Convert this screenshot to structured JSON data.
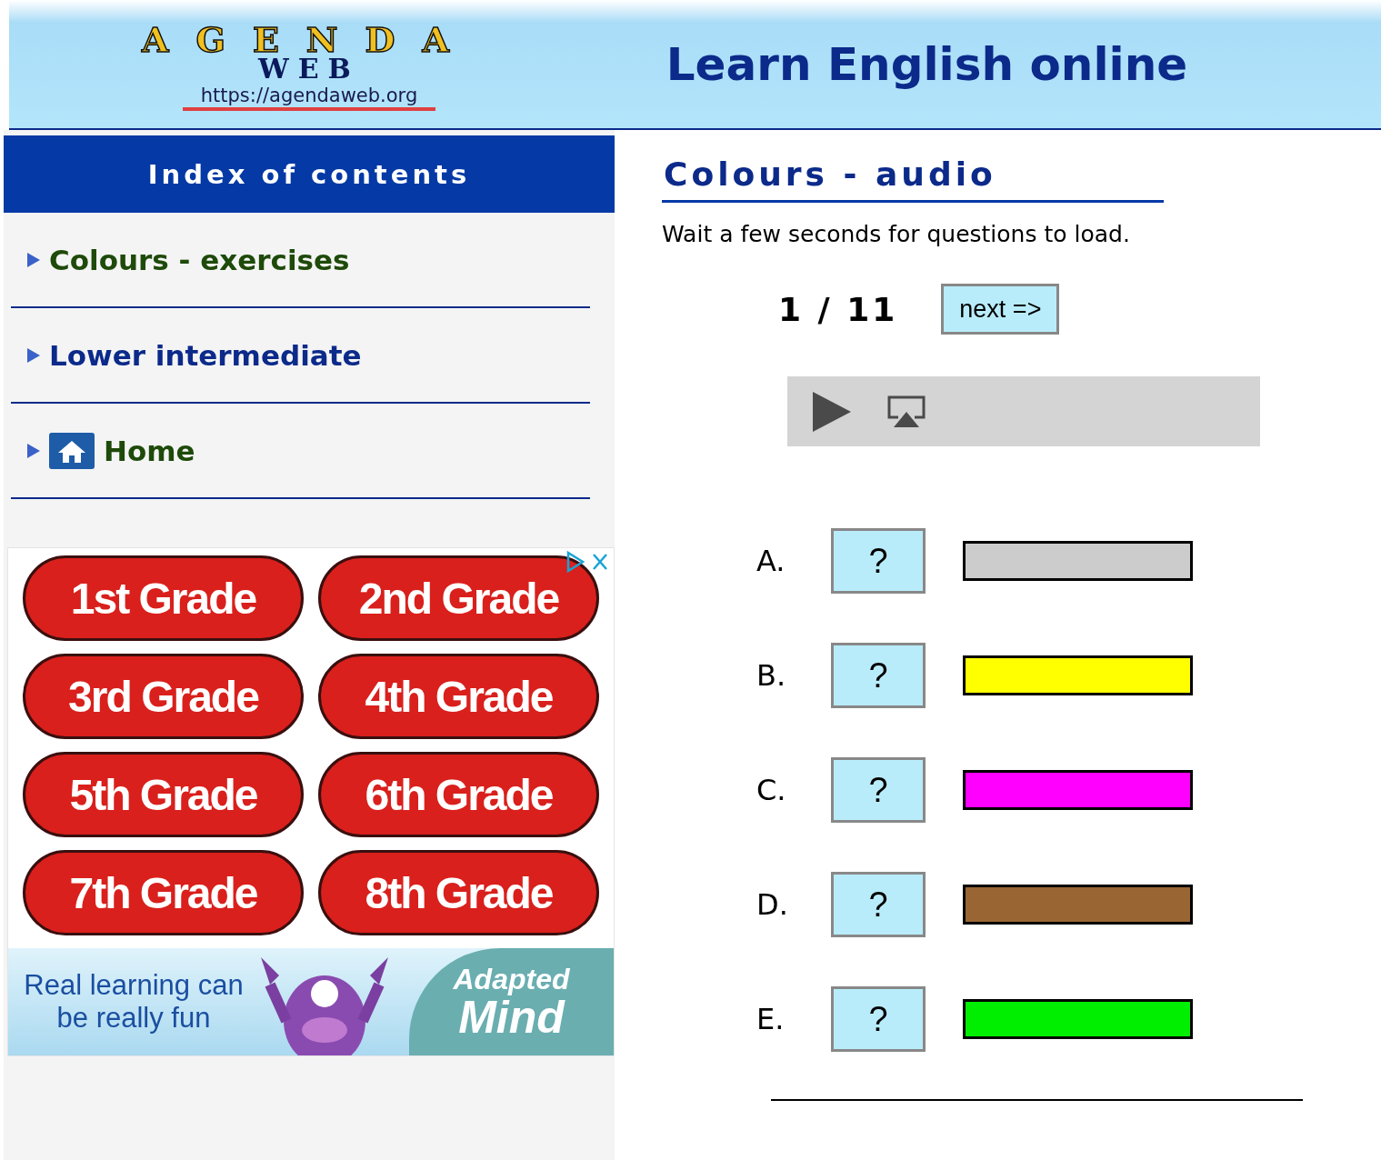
{
  "header": {
    "logo": {
      "word": "AGENDA",
      "sub": "WEB",
      "url": "https://agendaweb.org"
    },
    "title": "Learn English online"
  },
  "sidebar": {
    "title": "Index of contents",
    "items": [
      {
        "label": "Colours - exercises",
        "kind": "link",
        "color": "#1e4a0a"
      },
      {
        "label": "Lower intermediate",
        "kind": "link",
        "color": "#0b2a8a"
      },
      {
        "label": "Home",
        "kind": "home",
        "color": "#1e4a0a"
      }
    ]
  },
  "ad": {
    "grades": [
      "1st Grade",
      "2nd Grade",
      "3rd Grade",
      "4th Grade",
      "5th Grade",
      "6th Grade",
      "7th Grade",
      "8th Grade"
    ],
    "tagline": "Real learning can be really fun",
    "brand_top": "Adapted",
    "brand_bottom": "Mind"
  },
  "exercise": {
    "title": "Colours - audio",
    "instruction": "Wait a few seconds for questions to load.",
    "counter": "1 / 11",
    "next": "next =>",
    "options": [
      {
        "letter": "A.",
        "answer": "?",
        "color": "#cccccc"
      },
      {
        "letter": "B.",
        "answer": "?",
        "color": "#ffff00"
      },
      {
        "letter": "C.",
        "answer": "?",
        "color": "#ff00ff"
      },
      {
        "letter": "D.",
        "answer": "?",
        "color": "#996633"
      },
      {
        "letter": "E.",
        "answer": "?",
        "color": "#00ee00"
      }
    ]
  }
}
